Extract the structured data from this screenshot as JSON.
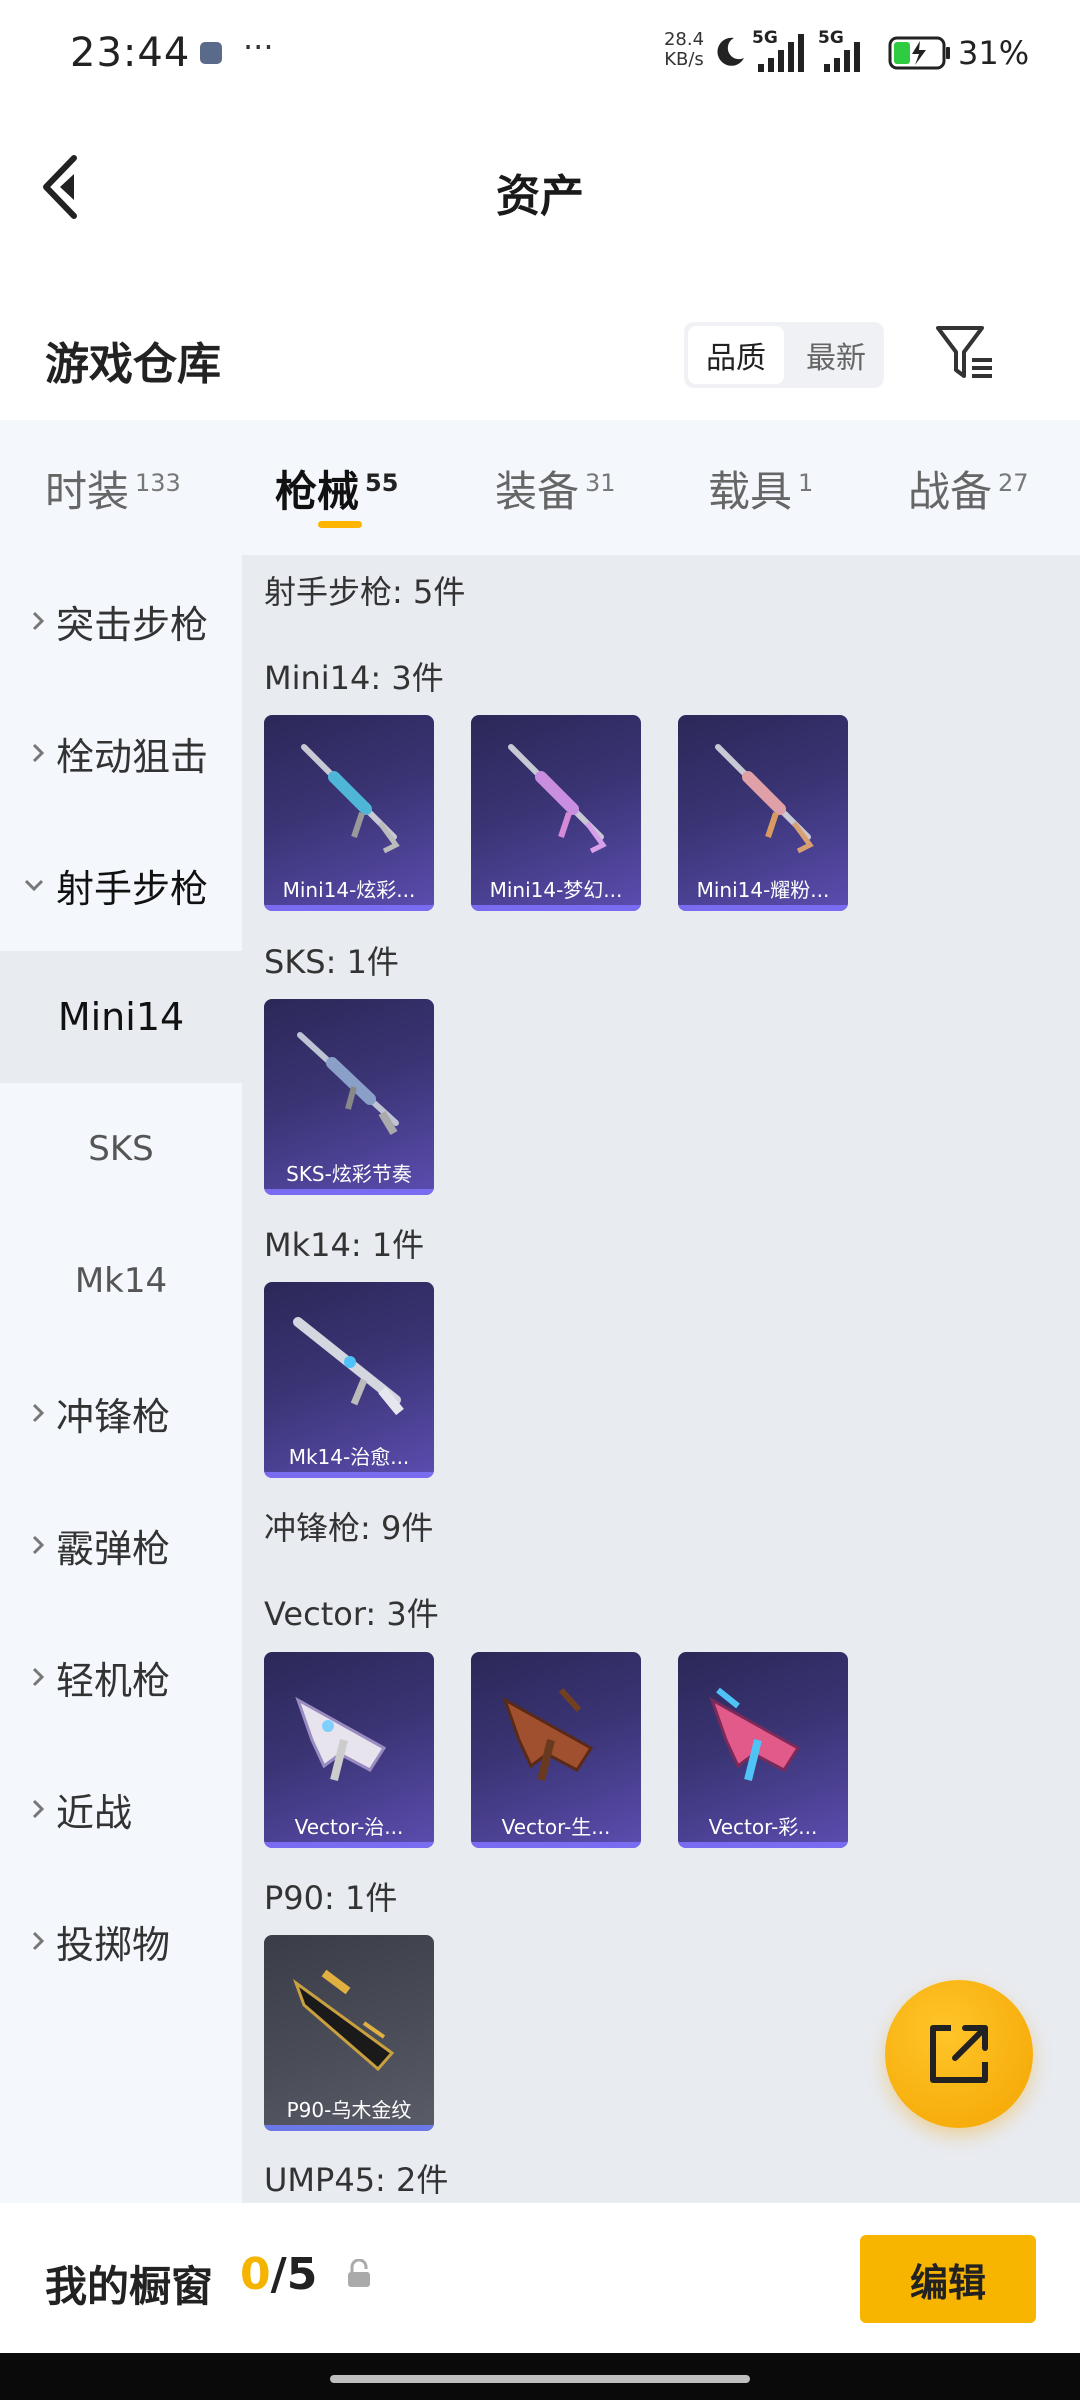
{
  "status_bar": {
    "time": "23:44",
    "dots": "···",
    "net_speed_value": "28.4",
    "net_speed_unit": "KB/s",
    "sig1": "5G",
    "sig2": "5G",
    "battery": "31%"
  },
  "header": {
    "title": "资产"
  },
  "warehouse": {
    "title": "游戏仓库",
    "sort_quality": "品质",
    "sort_newest": "最新"
  },
  "tabs": [
    {
      "label": "时装",
      "count": "133"
    },
    {
      "label": "枪械",
      "count": "55"
    },
    {
      "label": "装备",
      "count": "31"
    },
    {
      "label": "载具",
      "count": "1"
    },
    {
      "label": "战备",
      "count": "27"
    }
  ],
  "sidebar": {
    "items": [
      {
        "label": "突击步枪"
      },
      {
        "label": "栓动狙击"
      },
      {
        "label": "射手步枪"
      },
      {
        "label": "冲锋枪"
      },
      {
        "label": "霰弹枪"
      },
      {
        "label": "轻机枪"
      },
      {
        "label": "近战"
      },
      {
        "label": "投掷物"
      }
    ],
    "subitems": [
      {
        "label": "Mini14"
      },
      {
        "label": "SKS"
      },
      {
        "label": "Mk14"
      }
    ]
  },
  "content": {
    "sections": [
      {
        "label": "射手步枪: 5件"
      },
      {
        "label": "Mini14: 3件"
      },
      {
        "label": "SKS: 1件"
      },
      {
        "label": "Mk14: 1件"
      },
      {
        "label": "冲锋枪: 9件"
      },
      {
        "label": "Vector: 3件"
      },
      {
        "label": "P90: 1件"
      },
      {
        "label": "UMP45: 2件"
      }
    ],
    "mini14": [
      {
        "name": "Mini14-炫彩..."
      },
      {
        "name": "Mini14-梦幻..."
      },
      {
        "name": "Mini14-耀粉..."
      }
    ],
    "sks": [
      {
        "name": "SKS-炫彩节奏"
      }
    ],
    "mk14": [
      {
        "name": "Mk14-治愈..."
      }
    ],
    "vector": [
      {
        "name": "Vector-治..."
      },
      {
        "name": "Vector-生..."
      },
      {
        "name": "Vector-彩..."
      }
    ],
    "p90": [
      {
        "name": "P90-乌木金纹"
      }
    ]
  },
  "bottom": {
    "window_label": "我的橱窗",
    "count_current": "0",
    "count_sep_total": "/5",
    "edit": "编辑"
  },
  "colors": {
    "accent": "#f7b500",
    "card_purple": "#3a3474",
    "card_gray": "#4a4d58"
  }
}
